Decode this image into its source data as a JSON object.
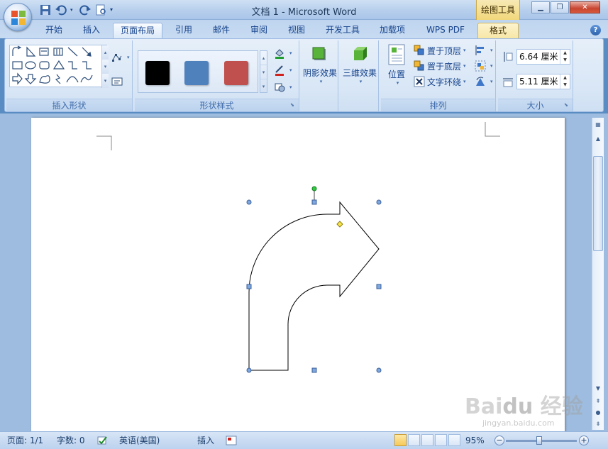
{
  "window": {
    "title": "文档 1 - Microsoft Word",
    "context_tab_group": "绘图工具"
  },
  "tabs": [
    "开始",
    "插入",
    "页面布局",
    "引用",
    "邮件",
    "审阅",
    "视图",
    "开发工具",
    "加载项",
    "WPS PDF",
    "格式"
  ],
  "ribbon": {
    "insert_shapes": {
      "label": "插入形状"
    },
    "shape_styles": {
      "label": "形状样式",
      "swatches": [
        "#000000",
        "#4f81bd",
        "#c0504d"
      ]
    },
    "shadow": {
      "label": "阴影效果"
    },
    "threed": {
      "label": "三维效果"
    },
    "arrange": {
      "label": "排列",
      "position": "位置",
      "bring_front": "置于顶层",
      "send_back": "置于底层",
      "text_wrap": "文字环绕"
    },
    "size": {
      "label": "大小",
      "height": "6.64 厘米",
      "width": "5.11 厘米"
    }
  },
  "statusbar": {
    "page": "页面: 1/1",
    "words": "字数: 0",
    "language": "英语(美国)",
    "mode": "插入",
    "zoom": "95%"
  },
  "watermark": {
    "brand": "Bai du 经验",
    "url": "jingyan.baidu.com"
  }
}
